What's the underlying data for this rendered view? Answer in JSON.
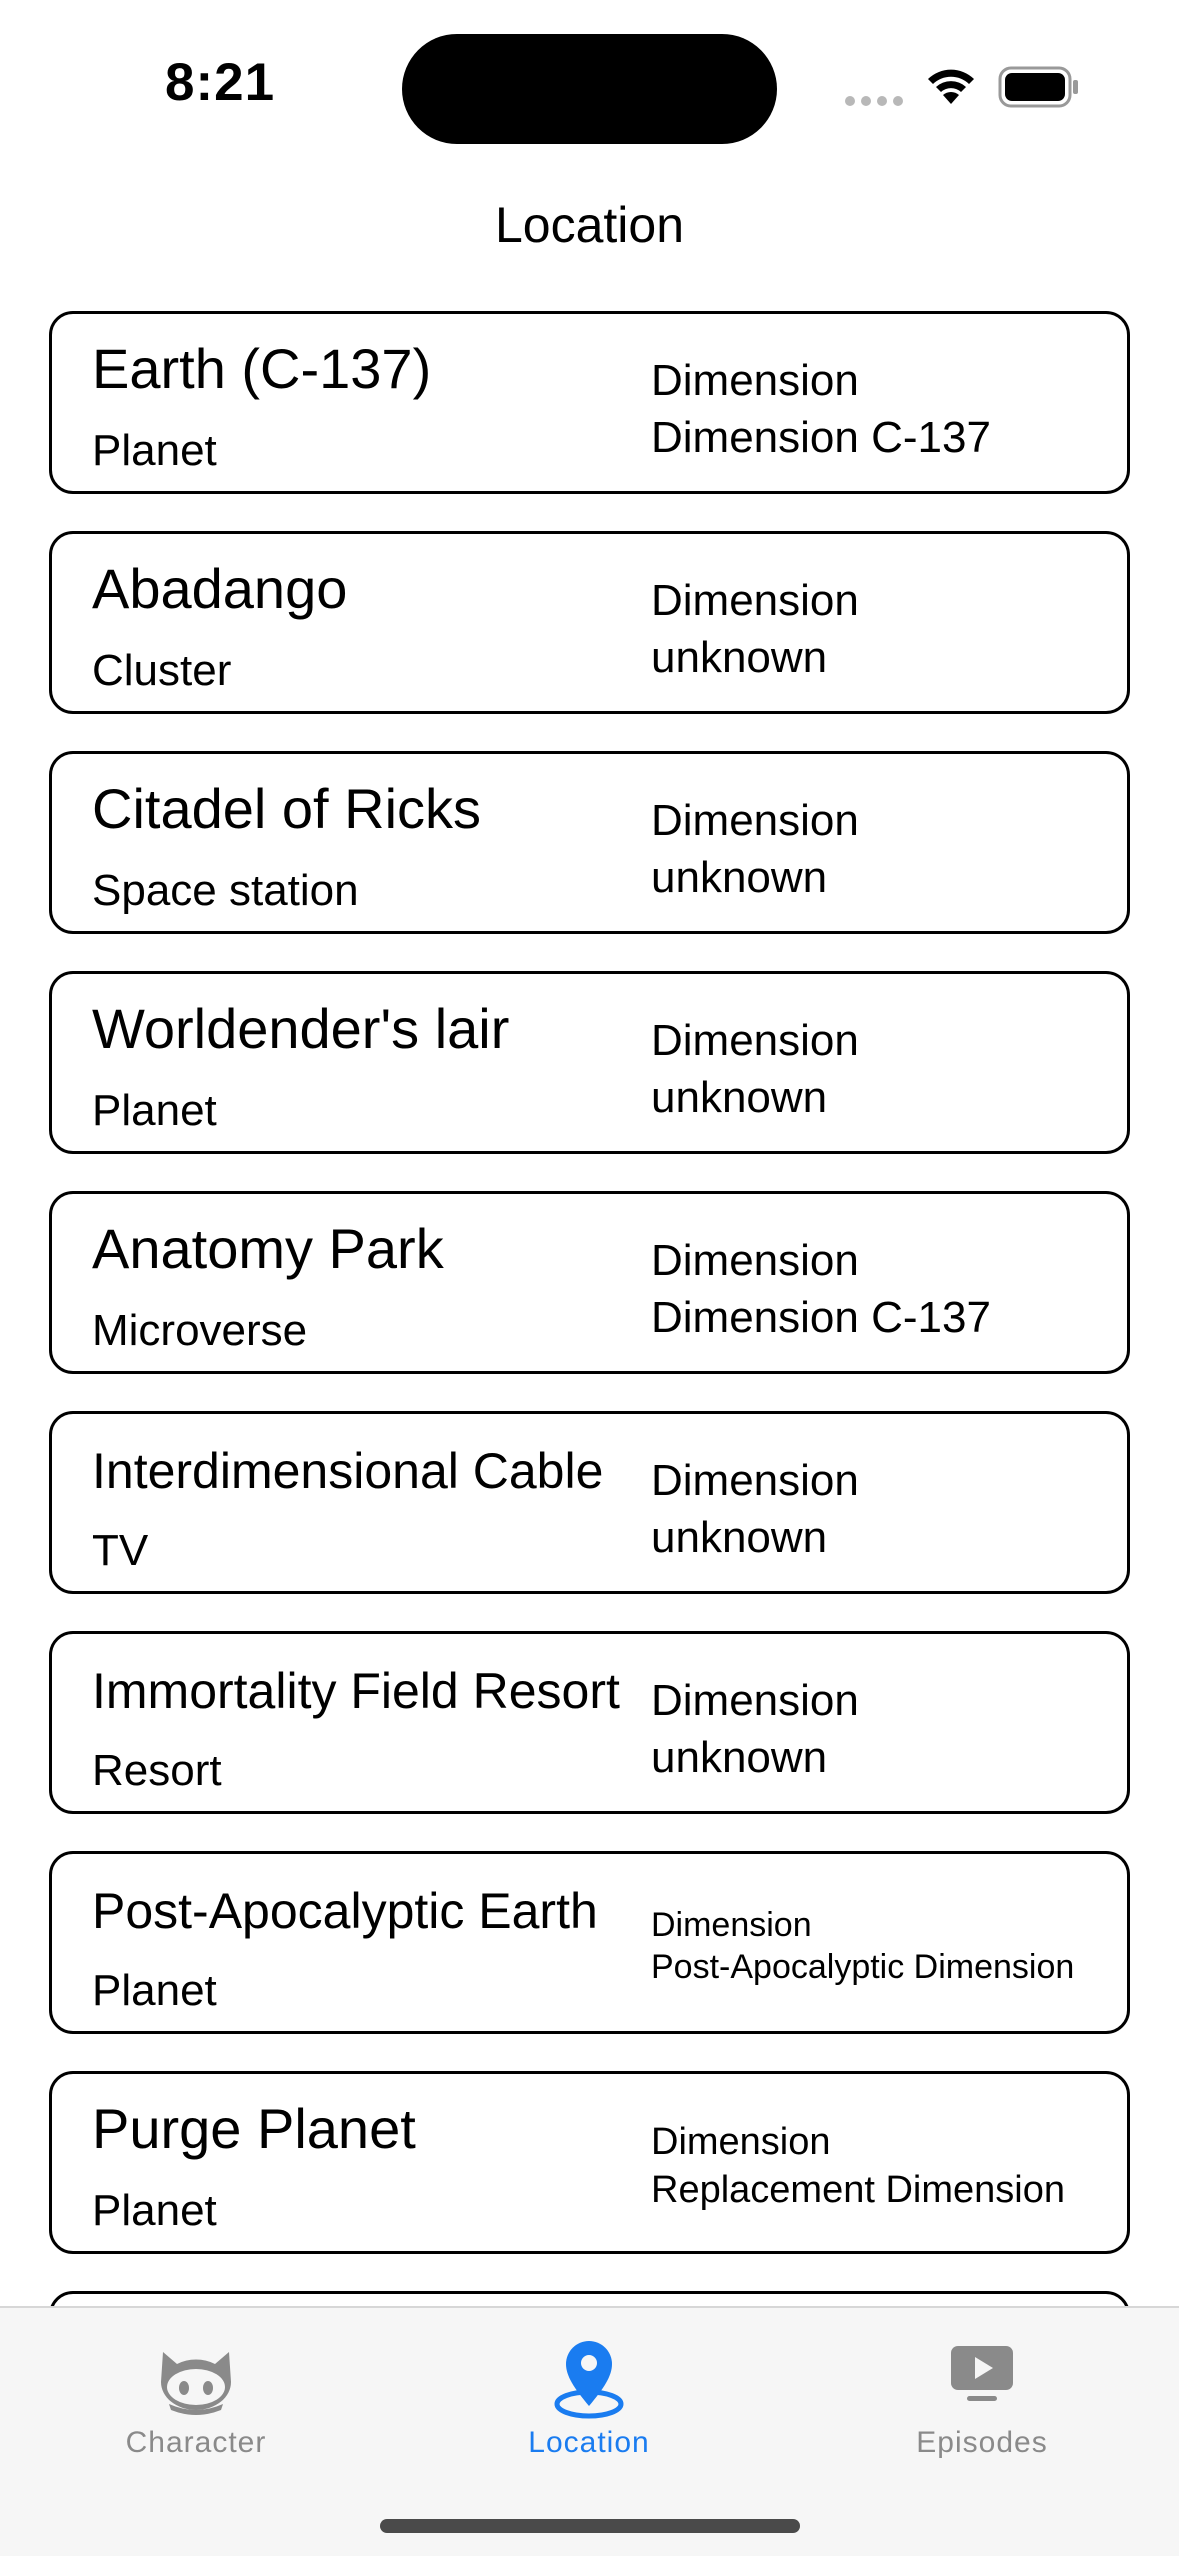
{
  "status_bar": {
    "time": "8:21"
  },
  "header": {
    "title": "Location"
  },
  "locations": [
    {
      "name": "Earth (C-137)",
      "type": "Planet",
      "dimension_label": "Dimension",
      "dimension": "Dimension C-137"
    },
    {
      "name": "Abadango",
      "type": "Cluster",
      "dimension_label": "Dimension",
      "dimension": "unknown"
    },
    {
      "name": "Citadel of Ricks",
      "type": "Space station",
      "dimension_label": "Dimension",
      "dimension": "unknown"
    },
    {
      "name": "Worldender's lair",
      "type": "Planet",
      "dimension_label": "Dimension",
      "dimension": "unknown"
    },
    {
      "name": "Anatomy Park",
      "type": "Microverse",
      "dimension_label": "Dimension",
      "dimension": "Dimension C-137"
    },
    {
      "name": "Interdimensional Cable",
      "type": "TV",
      "dimension_label": "Dimension",
      "dimension": "unknown"
    },
    {
      "name": "Immortality Field Resort",
      "type": "Resort",
      "dimension_label": "Dimension",
      "dimension": "unknown"
    },
    {
      "name": "Post-Apocalyptic Earth",
      "type": "Planet",
      "dimension_label": "Dimension",
      "dimension": "Post-Apocalyptic Dimension"
    },
    {
      "name": "Purge Planet",
      "type": "Planet",
      "dimension_label": "Dimension",
      "dimension": "Replacement Dimension"
    }
  ],
  "tabbar": {
    "tabs": [
      {
        "label": "Character",
        "icon": "github-cat-icon",
        "selected": false
      },
      {
        "label": "Location",
        "icon": "location-pin-icon",
        "selected": true
      },
      {
        "label": "Episodes",
        "icon": "play-screen-icon",
        "selected": false
      }
    ],
    "active_color": "#1a7cf0",
    "inactive_color": "#8a8a8a"
  }
}
